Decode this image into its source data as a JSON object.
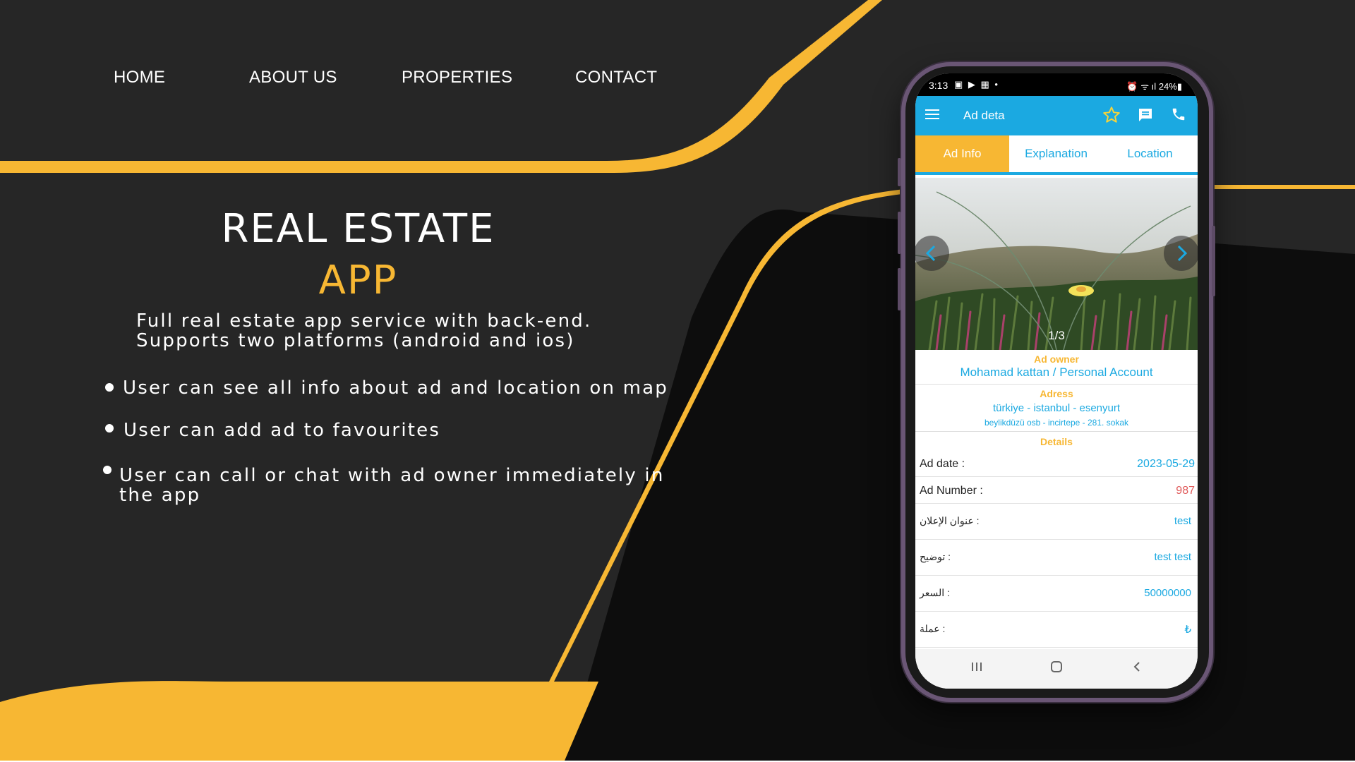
{
  "nav": {
    "home": "HOME",
    "about": "ABOUT US",
    "properties": "PROPERTIES",
    "contact": "CONTACT"
  },
  "hero": {
    "title_line1": "REAL ESTATE",
    "title_line2": "APP",
    "description_line1": "Full real estate app service with back-end.",
    "description_line2": "Supports two platforms (android and ios)",
    "features": [
      "User can see all info about ad and location on map",
      "User can add ad to favourites",
      "User can call or chat with ad owner immediately in",
      "the app"
    ]
  },
  "phone": {
    "status": {
      "time": "3:13",
      "left_icons": "▣ ▶ ▦ •",
      "battery": "24%"
    },
    "app_bar": {
      "menu_icon": "menu-icon",
      "title": "Ad deta",
      "favorite_icon": "star-icon",
      "chat_icon": "chat-icon",
      "call_icon": "phone-icon"
    },
    "tabs": [
      "Ad Info",
      "Explanation",
      "Location"
    ],
    "gallery": {
      "counter": "1/3"
    },
    "owner": {
      "label": "Ad owner",
      "value": "Mohamad kattan  / Personal Account"
    },
    "address": {
      "label": "Adress",
      "line1": "türkiye - istanbul - esenyurt",
      "line2": "beylikdüzü osb - incirtepe - 281. sokak"
    },
    "details": {
      "label": "Details",
      "rows": [
        {
          "label": "Ad date :",
          "value": "2023-05-29"
        },
        {
          "label": "Ad Number :",
          "value": "987"
        },
        {
          "label": "عنوان الإعلان :",
          "value": "test"
        },
        {
          "label": "توضيح :",
          "value": "test test"
        },
        {
          "label": "السعر :",
          "value": "50000000"
        },
        {
          "label": "عملة :",
          "value": "₺"
        }
      ]
    },
    "colors": {
      "primary": "#1ba9e1",
      "accent": "#f7b733",
      "number": "#e05a5a"
    }
  },
  "colors": {
    "background": "#262626",
    "accent": "#f7b733",
    "text": "#ffffff"
  }
}
